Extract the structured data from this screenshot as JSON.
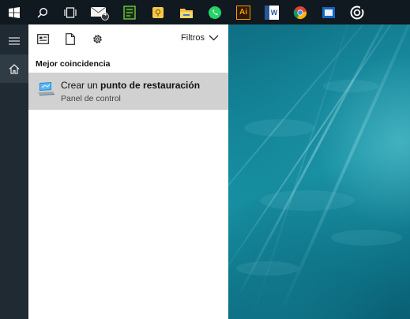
{
  "taskbar": {
    "icons": [
      "windows-start-icon",
      "search-icon",
      "task-view-icon",
      "mail-icon",
      "book-app-icon",
      "sticky-notes-icon",
      "file-explorer-icon",
      "whatsapp-icon",
      "illustrator-icon",
      "word-icon",
      "chrome-icon",
      "blue-app-icon",
      "circle-app-icon"
    ],
    "illustrator_label": "Ai",
    "word_label": "W",
    "mail_badge": "4"
  },
  "rail": {
    "icons": [
      "hamburger-menu-icon",
      "home-icon"
    ]
  },
  "panel": {
    "toolbar_icons": [
      "apps-icon",
      "documents-icon",
      "settings-icon"
    ],
    "filters_label": "Filtros",
    "section_label": "Mejor coincidencia",
    "best_match": {
      "title_prefix": "Crear un ",
      "title_bold": "punto de restauración",
      "subtitle": "Panel de control",
      "icon": "system-restore-icon"
    }
  },
  "colors": {
    "taskbar": "#101820",
    "rail": "#1f2a33",
    "panel": "#ffffff",
    "result_highlight": "#d1d1d1",
    "wallpaper": "#1796a8"
  }
}
